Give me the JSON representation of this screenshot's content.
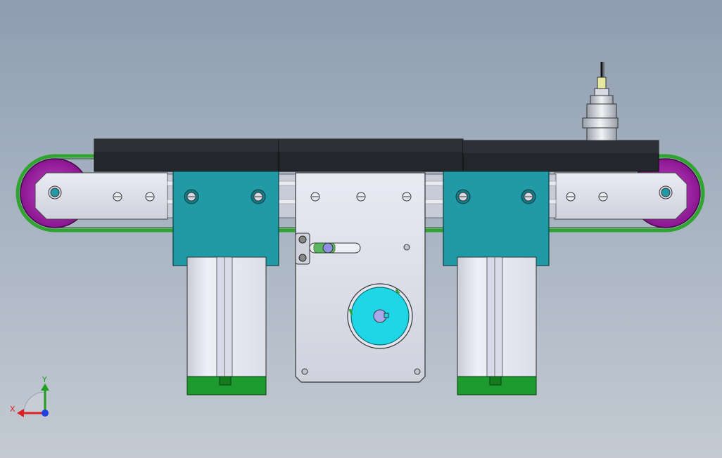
{
  "viewport": {
    "background_top": "#8e9db0",
    "background_bottom": "#c3cad3"
  },
  "triad": {
    "x_label": "X",
    "y_label": "Y",
    "x_color": "#e02020",
    "y_color": "#1ea01e",
    "z_color": "#2040e0"
  },
  "colors": {
    "belt": "#2fa42f",
    "pulley": "#a21fa8",
    "top_plate": "#23272b",
    "bracket": "#1f9aa6",
    "side_plate": "#d8dbe6",
    "motor_body": "#e6e8f2",
    "motor_base": "#1e9b2e",
    "spindle_face": "#1fd6e6"
  }
}
